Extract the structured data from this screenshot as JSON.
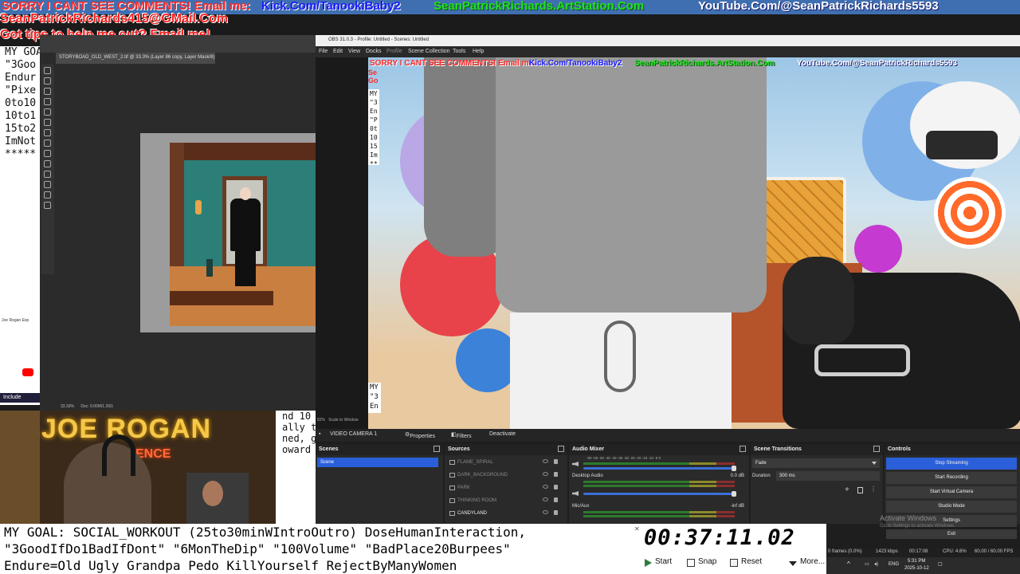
{
  "overlay": {
    "banner_line1_a": "SORRY I CANT SEE COMMENTS! Email me:",
    "banner_kick": "Kick.Com/TanookiBaby2",
    "banner_artstation": "SeanPatrickRichards.ArtStation.Com",
    "banner_youtube": "YouTube.Com/@SeanPatrickRichards5593",
    "email": "SeanPatrickRichards415@GMail.Com",
    "tips": "Got tips to help me out? Email me!"
  },
  "notes_left": [
    "MY GOA",
    "\"3Goo",
    "Endur",
    "\"Pixe",
    "0to10",
    "10to1",
    "15to2",
    "ImNot",
    "*****"
  ],
  "photoshop": {
    "doc_tab": "STORYBOAD_OLD_WEST_2.tif @ 33.3% (Layer 86 copy, Layer Mask/8) *",
    "zoom": "33.33%",
    "doc_info": "Doc: 9.00M/1.26G"
  },
  "chrome": {
    "tab_title": "Joe Rogan Exp",
    "notif": "Include"
  },
  "jre": {
    "logo": "JOE ROGAN",
    "sub": "ENCE"
  },
  "snippet": [
    "nd 10",
    "ally ta",
    "ned, gr",
    "",
    "oward u"
  ],
  "obs": {
    "title": "OBS 31.0.3 - Profile: Untitled - Scenes: Untitled",
    "menu": [
      "File",
      "Edit",
      "View",
      "Docks",
      "Profile",
      "Scene Collection",
      "Tools",
      "Help"
    ],
    "preview_left": [
      "Se",
      "Go"
    ],
    "preview_notes": [
      "MY",
      "\"3",
      "En",
      "\"P",
      "0t",
      "10",
      "15",
      "Im",
      "**"
    ],
    "preview_notes2": [
      "MY",
      "\"3",
      "En"
    ],
    "zoom_label": "82%",
    "scale_label": "Scale to Window",
    "source_bar": {
      "source_name": "VIDEO CAMERA 1",
      "properties": "Properties",
      "filters": "Filters",
      "deactivate": "Deactivate"
    },
    "scenes": {
      "title": "Scenes",
      "items": [
        "Scene"
      ]
    },
    "sources": {
      "title": "Sources",
      "items": [
        "FLAME_SPIRAL",
        "DARK_BACKGROUND",
        "PARK",
        "THINKING ROOM",
        "CANDYLAND"
      ]
    },
    "mixer": {
      "title": "Audio Mixer",
      "ticks": "-60 -55 -50 -45 -40 -35 -30 -25 -20 -15 -10 -5 0",
      "channels": [
        {
          "name": "Desktop Audio",
          "value": "0.0 dB"
        },
        {
          "name": "Mic/Aux",
          "value": "-inf dB"
        }
      ]
    },
    "transitions": {
      "title": "Scene Transitions",
      "selected": "Fade",
      "duration_label": "Duration",
      "duration_value": "300 ms"
    },
    "controls": {
      "title": "Controls",
      "buttons": [
        "Stop Streaming",
        "Start Recording",
        "Start Virtual Camera",
        "Studio Mode",
        "Settings",
        "Exit"
      ]
    },
    "status": {
      "frames": "0 frames (0.0%)",
      "bitrate": "1423 kbps",
      "duration": "00:17:08",
      "cpu": "CPU: 4.6%",
      "fps": "60.00 / 60.00 FPS"
    }
  },
  "activate_windows": {
    "title": "Activate Windows",
    "sub": "Go to Settings to activate Windows."
  },
  "goal_text": [
    "MY GOAL: SOCIAL_WORKOUT (25to30minWIntroOutro) DoseHumanInteraction,",
    "\"3GoodIfDo1BadIfDont\" \"6MonTheDip\" \"100Volume\" \"BadPlace20Burpees\"",
    "Endure=Old Ugly Grandpa Pedo KillYourself RejectByManyWomen"
  ],
  "stopwatch": {
    "time": "00:37:11.02",
    "start": "Start",
    "snap": "Snap",
    "reset": "Reset",
    "more": "More..."
  },
  "taskbar": {
    "lang": "ENG",
    "time": "5:31 PM",
    "date": "2025-10-12"
  }
}
